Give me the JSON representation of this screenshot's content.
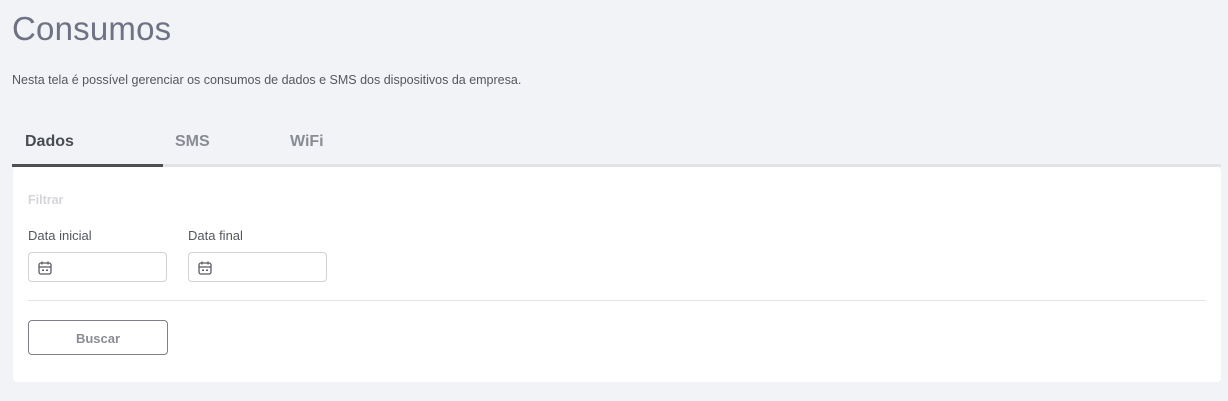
{
  "page": {
    "title": "Consumos",
    "subtitle": "Nesta tela é possível gerenciar os consumos de dados e SMS dos dispositivos da empresa."
  },
  "tabs": [
    {
      "label": "Dados",
      "active": true
    },
    {
      "label": "SMS",
      "active": false
    },
    {
      "label": "WiFi",
      "active": false
    }
  ],
  "filter": {
    "heading": "Filtrar",
    "start_date": {
      "label": "Data inicial",
      "value": "",
      "icon": "calendar-icon"
    },
    "end_date": {
      "label": "Data final",
      "value": "",
      "icon": "calendar-icon"
    },
    "search_button": "Buscar"
  },
  "colors": {
    "background": "#f2f3f7",
    "card": "#ffffff",
    "active_tab_indicator": "#4d4f55"
  }
}
